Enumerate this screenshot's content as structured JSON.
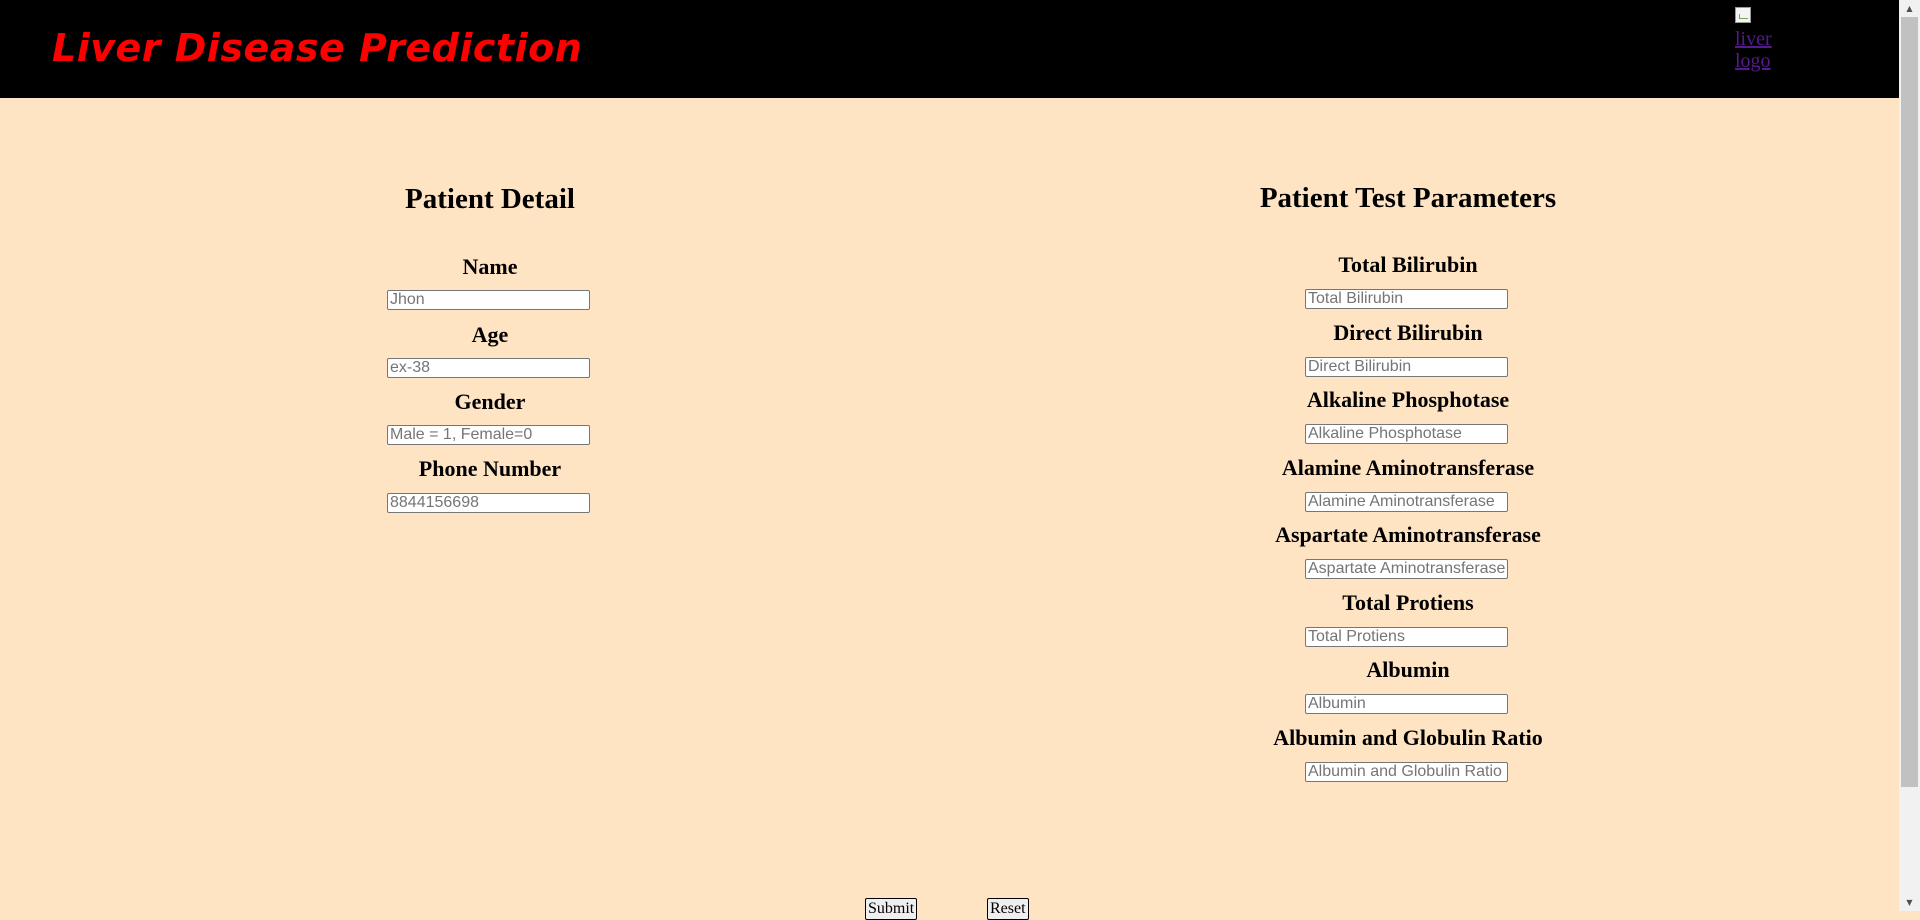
{
  "header": {
    "title": "Liver Disease Prediction",
    "logo_alt": "liver logo"
  },
  "patient_detail": {
    "heading": "Patient Detail",
    "fields": [
      {
        "label": "Name",
        "placeholder": "Jhon"
      },
      {
        "label": "Age",
        "placeholder": "ex-38"
      },
      {
        "label": "Gender",
        "placeholder": "Male = 1, Female=0"
      },
      {
        "label": "Phone Number",
        "placeholder": "8844156698"
      }
    ]
  },
  "test_parameters": {
    "heading": "Patient Test Parameters",
    "fields": [
      {
        "label": "Total Bilirubin",
        "placeholder": "Total Bilirubin"
      },
      {
        "label": "Direct Bilirubin",
        "placeholder": "Direct Bilirubin"
      },
      {
        "label": "Alkaline Phosphotase",
        "placeholder": "Alkaline Phosphotase"
      },
      {
        "label": "Alamine Aminotransferase",
        "placeholder": "Alamine Aminotransferase"
      },
      {
        "label": "Aspartate Aminotransferase",
        "placeholder": "Aspartate Aminotransferase"
      },
      {
        "label": "Total Protiens",
        "placeholder": "Total Protiens"
      },
      {
        "label": "Albumin",
        "placeholder": "Albumin"
      },
      {
        "label": "Albumin and Globulin Ratio",
        "placeholder": "Albumin and Globulin Ratio"
      }
    ]
  },
  "actions": {
    "submit_label": "Submit",
    "reset_label": "Reset"
  },
  "colors": {
    "page_background": "#ffe4c4",
    "header_background": "#000000",
    "title_color": "#ff0000",
    "link_color": "#551a8b"
  },
  "icons": {
    "logo": "broken-image-icon",
    "scroll_up": "triangle-up-icon",
    "scroll_down": "triangle-down-icon"
  }
}
